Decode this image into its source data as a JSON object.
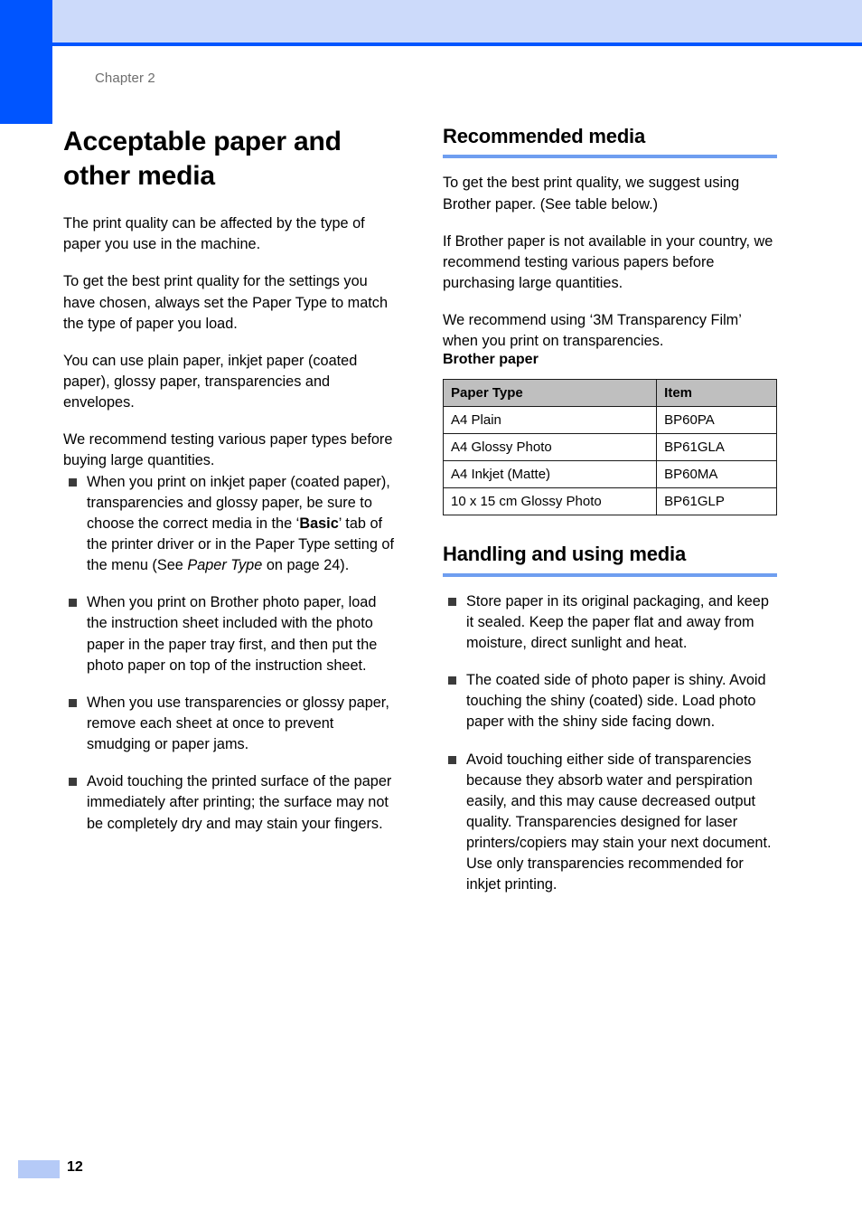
{
  "colors": {
    "accent_bar": "#0055ff",
    "header_band": "#ccdafa",
    "section_underline": "#6f9ef0",
    "table_header_bg": "#bfbfbf",
    "footer_swatch": "#b5caf7",
    "chapter_label": "#6d6d6d"
  },
  "header": {
    "chapter_label": "Chapter 2"
  },
  "left_column": {
    "page_title": "Acceptable paper and other media",
    "paragraphs": [
      "The print quality can be affected by the type of paper you use in the machine.",
      "To get the best print quality for the settings you have chosen, always set the Paper Type to match the type of paper you load.",
      "You can use plain paper, inkjet paper (coated paper), glossy paper, transparencies and envelopes.",
      "We recommend testing various paper types before buying large quantities."
    ],
    "bullets": [
      {
        "runs": [
          {
            "text": "When you print on inkjet paper (coated paper), transparencies and glossy paper, be sure to choose the correct media in the ‘",
            "style": "normal"
          },
          {
            "text": "Basic",
            "style": "bold"
          },
          {
            "text": "’ tab of the printer driver or in the Paper Type setting of the menu (See ",
            "style": "normal"
          },
          {
            "text": "Paper Type",
            "style": "italic"
          },
          {
            "text": " on page 24).",
            "style": "normal"
          }
        ]
      },
      {
        "runs": [
          {
            "text": "When you print on Brother photo paper, load the instruction sheet included with the photo paper in the paper tray first, and then put the photo paper on top of the instruction sheet.",
            "style": "normal"
          }
        ]
      },
      {
        "runs": [
          {
            "text": "When you use transparencies or glossy paper, remove each sheet at once to prevent smudging or paper jams.",
            "style": "normal"
          }
        ]
      },
      {
        "runs": [
          {
            "text": "Avoid touching the printed surface of the paper immediately after printing; the surface may not be completely dry and may stain your fingers.",
            "style": "normal"
          }
        ]
      }
    ]
  },
  "right_column": {
    "recommended_media": {
      "heading": "Recommended media",
      "paragraphs": [
        "To get the best print quality, we suggest using Brother paper. (See table below.)",
        "If Brother paper is not available in your country, we recommend testing various papers before purchasing large quantities.",
        "We recommend using ‘3M Transparency Film’ when you print on transparencies."
      ],
      "subheading": "Brother paper",
      "table": {
        "columns": [
          "Paper Type",
          "Item"
        ],
        "rows": [
          [
            "A4 Plain",
            "BP60PA"
          ],
          [
            "A4 Glossy Photo",
            "BP61GLA"
          ],
          [
            "A4 Inkjet (Matte)",
            "BP60MA"
          ],
          [
            "10 x 15 cm Glossy Photo",
            "BP61GLP"
          ]
        ]
      }
    },
    "handling_media": {
      "heading": "Handling and using media",
      "bullets": [
        "Store paper in its original packaging, and keep it sealed. Keep the paper flat and away from moisture, direct sunlight and heat.",
        "The coated side of photo paper is shiny. Avoid touching the shiny (coated) side. Load photo paper with the shiny side facing down.",
        "Avoid touching either side of transparencies because they absorb water and perspiration easily, and this may cause decreased output quality. Transparencies designed for laser printers/copiers may stain your next document. Use only transparencies recommended for inkjet printing."
      ]
    }
  },
  "footer": {
    "page_number": "12"
  }
}
